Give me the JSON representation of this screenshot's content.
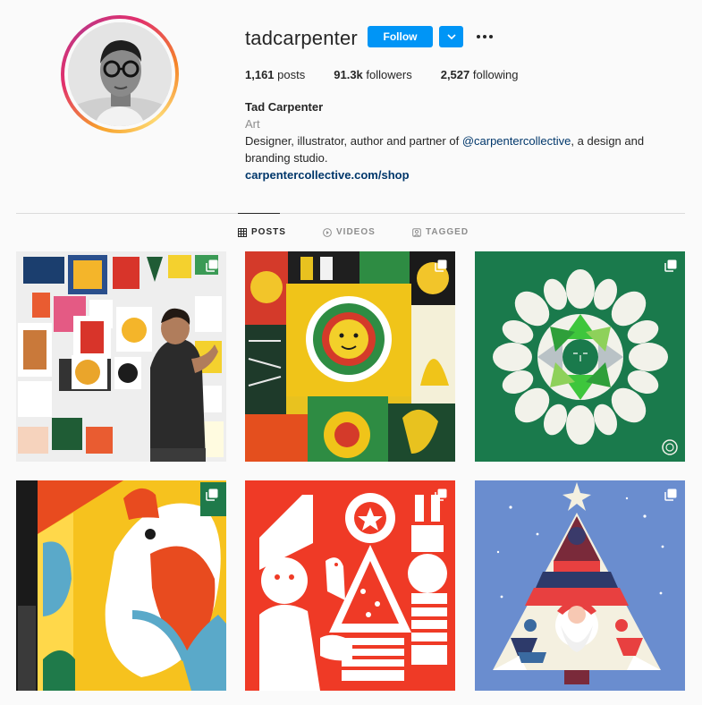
{
  "profile": {
    "username": "tadcarpenter",
    "follow_label": "Follow",
    "stats": {
      "posts_count": "1,161",
      "posts_label": "posts",
      "followers_count": "91.3k",
      "followers_label": "followers",
      "following_count": "2,527",
      "following_label": "following"
    },
    "full_name": "Tad Carpenter",
    "category": "Art",
    "bio_before": "Designer, illustrator, author and partner of ",
    "bio_mention": "@carpentercollective",
    "bio_after": ", a design and branding studio.",
    "website": "carpentercollective.com/shop"
  },
  "tabs": [
    {
      "label": "POSTS",
      "icon": "grid-icon",
      "active": true
    },
    {
      "label": "VIDEOS",
      "icon": "play-circle-icon",
      "active": false
    },
    {
      "label": "TAGGED",
      "icon": "tag-icon",
      "active": false
    }
  ],
  "colors": {
    "accent": "#0095f6",
    "link": "#00376b",
    "muted": "#8e8e8e",
    "text": "#262626",
    "background": "#fafafa"
  },
  "posts": [
    {
      "subject": "artist-at-wall-of-prints",
      "multi": true
    },
    {
      "subject": "yellow-sun-prints",
      "multi": true
    },
    {
      "subject": "dove-wreath-on-green",
      "multi": true
    },
    {
      "subject": "bird-mural-on-building",
      "multi": true
    },
    {
      "subject": "red-holiday-illustration",
      "multi": true
    },
    {
      "subject": "santa-christmas-tree",
      "multi": true
    }
  ]
}
